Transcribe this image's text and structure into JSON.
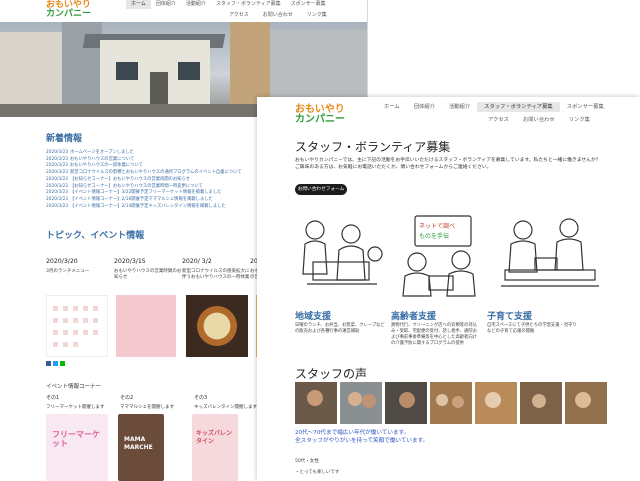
{
  "brand": {
    "logo_line1": "おもいやり",
    "logo_line2": "カンパニー"
  },
  "nav": {
    "row1": [
      "ホーム",
      "団体紹介",
      "活動紹介",
      "スタッフ・ボランティア募集",
      "スポンサー募集"
    ],
    "row2": [
      "アクセス",
      "お問い合わせ",
      "リンク集"
    ]
  },
  "home": {
    "news_title": "新着情報",
    "news": [
      {
        "date": "2020/3/23",
        "text": "ホームページをオープンしました"
      },
      {
        "date": "2020/3/23",
        "text": "おもいやりハウスの営業について"
      },
      {
        "date": "2020/3/23",
        "text": "おもいやりハウスの一部休業について"
      },
      {
        "date": "2020/3/23",
        "text": "新型コロナウイルスの影響とおもいやりハウスの通所プログラムのイベント自粛について"
      },
      {
        "date": "2020/3/23",
        "text": "【お知らせコーナー】おもいやりハウスの営業再開のお知らせ"
      },
      {
        "date": "2020/3/23",
        "text": "【お知らせコーナー】おもいやりハウスの営業時間一時変更について"
      },
      {
        "date": "2020/3/23",
        "text": "【イベント情報コーナー】3/22開催予定フリーマーケット情報を掲載しました"
      },
      {
        "date": "2020/3/23",
        "text": "【イベント情報コーナー】2/16開催予定マママルシェ情報を掲載しました"
      },
      {
        "date": "2020/3/23",
        "text": "【イベント情報コーナー】2/14開催予定キッズバレンタイン情報を掲載しました"
      }
    ],
    "topics_title": "トピック、イベント情報",
    "topics": [
      {
        "date": "2020/3/20",
        "desc": "3月のランチメニュー"
      },
      {
        "date": "2020/3/15",
        "desc": "おもいやりハウスの営業時間のお知らせ"
      },
      {
        "date": "2020/ 3/2",
        "desc": "新型コロナウイルスの感染拡大に伴うおもいやりハウスの一時休業"
      },
      {
        "date": "2020/",
        "desc": "おもいやりハウスの営業"
      }
    ],
    "event_corner": "イベント情報コーナー",
    "events": [
      {
        "no": "その1",
        "caption": "フリーマーケット開催します"
      },
      {
        "no": "その2",
        "caption": "マママルシェを開催します"
      },
      {
        "no": "その3",
        "caption": "キッズバレンタイン開催します"
      }
    ],
    "flyer_texts": [
      "フリーマーケット",
      "MAMA MARCHE",
      "キッズバレンタイン"
    ]
  },
  "staff_page": {
    "title": "スタッフ・ボランティア募集",
    "intro": "おもいやりカンパニーでは、主に下記の活動をお手伝いいただけるスタッフ・ボランティアを募集しています。私たちと一緒に働きませんか？ご興味のある方は、お気軽にお電話いただくか、問い合わせフォームからご連絡ください。",
    "form_button": "お問い合わせフォーム",
    "categories": [
      {
        "title": "地域支援",
        "desc": "日曜のランチ、お弁当、お惣菜、クレープなどの販売および各種行事の運営補助"
      },
      {
        "title": "高齢者支援",
        "desc": "買物代行、クリーニング店への衣類等の持込み・受取、宅配便の受付、話し相手、通院および事前事後準備等を中心とした高齢者向けの介護予防に関するプログラムの提供"
      },
      {
        "title": "子育て支援",
        "desc": "自宅スペースにて子供たちの学習支援・見守りなどの子育て応援の開催"
      }
    ],
    "voice_title": "スタッフの声",
    "voice_text_1": "20代〜70代まで幅広い年代が働いています。",
    "voice_text_2": "全スタッフがやりがいを持って笑顔で働いています。",
    "voice_meta": "50代・女性",
    "voice_item": "・とっても楽しいです"
  },
  "colors": {
    "accent_blue": "#3a6ea5",
    "logo_orange": "#e88a1a",
    "logo_green": "#2f9d3a",
    "button_dark": "#1c1c1c"
  }
}
